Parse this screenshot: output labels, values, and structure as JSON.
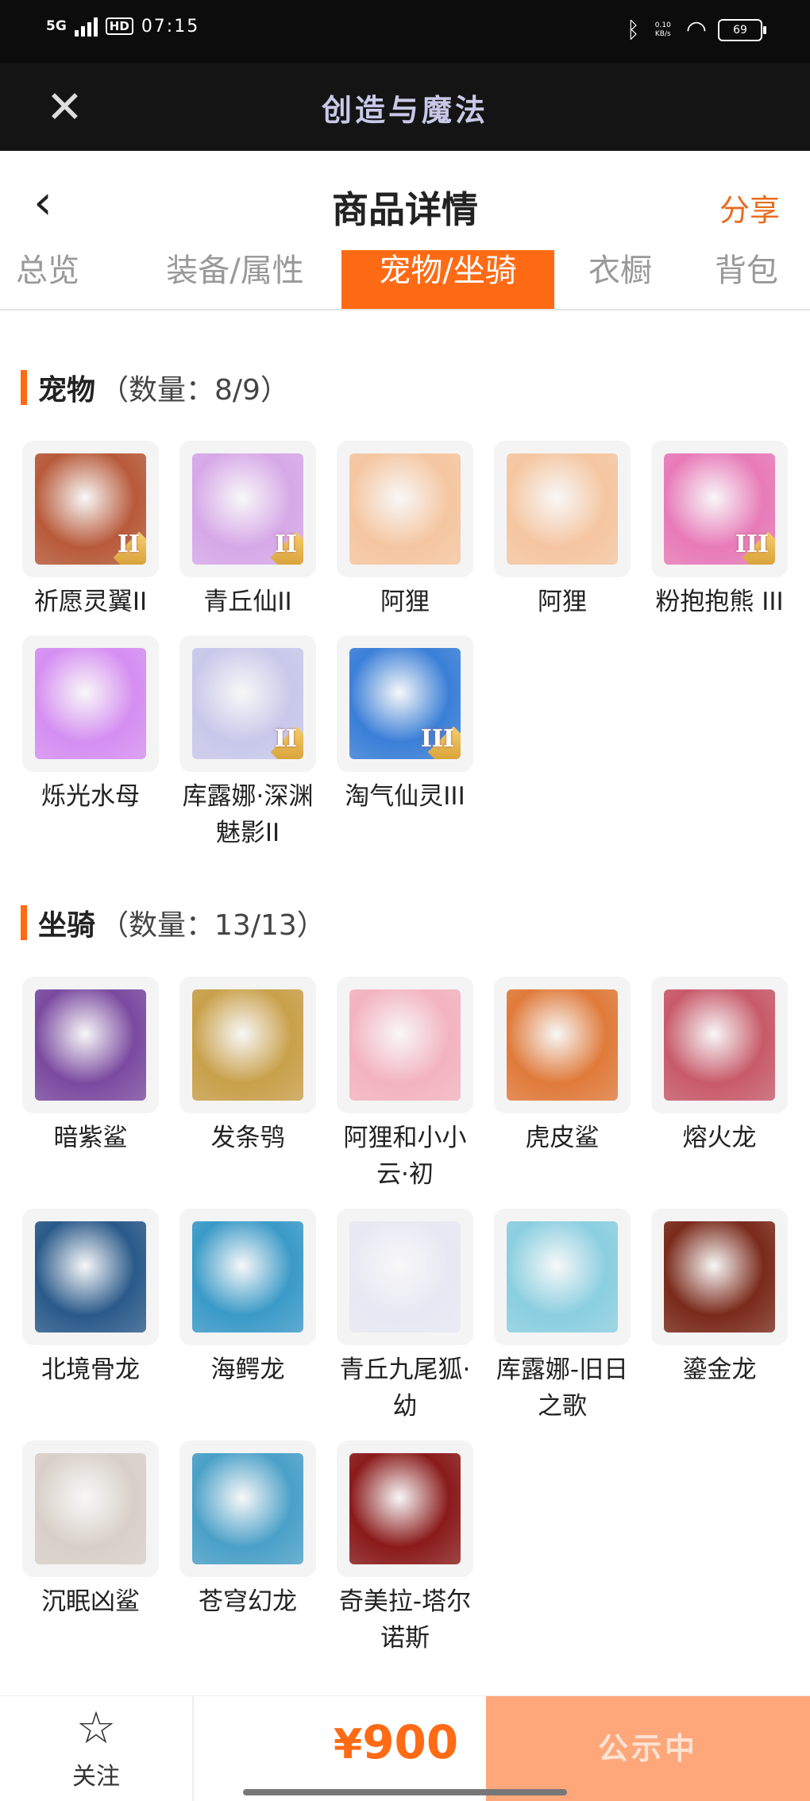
{
  "status_bar": {
    "network": "5G",
    "hd": "HD",
    "time": "07:15",
    "speed": "0.10 KB/s",
    "battery": "69"
  },
  "app_bar": {
    "title": "创造与魔法"
  },
  "nav": {
    "title": "商品详情",
    "share": "分享"
  },
  "tabs": [
    "总览",
    "装备/属性",
    "宠物/坐骑",
    "衣橱",
    "背包"
  ],
  "active_tab": "宠物/坐骑",
  "pets": {
    "label": "宠物",
    "count": "（数量：8/9）",
    "items": [
      {
        "name": "祈愿灵翼II",
        "rank": "II",
        "color": "#b85a3a"
      },
      {
        "name": "青丘仙II",
        "rank": "II",
        "color": "#d6a8e8"
      },
      {
        "name": "阿狸",
        "rank": "",
        "color": "#f5c6a0"
      },
      {
        "name": "阿狸",
        "rank": "",
        "color": "#f5c6a0"
      },
      {
        "name": "粉抱抱熊 III",
        "rank": "III",
        "color": "#e87ab8"
      },
      {
        "name": "烁光水母",
        "rank": "",
        "color": "#d58ef2"
      },
      {
        "name": "库露娜·深渊魅影II",
        "rank": "II",
        "color": "#c8c8ea"
      },
      {
        "name": "淘气仙灵III",
        "rank": "III",
        "color": "#3a7fd8"
      }
    ]
  },
  "mounts": {
    "label": "坐骑",
    "count": "（数量：13/13）",
    "items": [
      {
        "name": "暗紫鲨",
        "color": "#7a4aa0"
      },
      {
        "name": "发条鸮",
        "color": "#c9a04a"
      },
      {
        "name": "阿狸和小小云·初",
        "color": "#f3b3c0"
      },
      {
        "name": "虎皮鲨",
        "color": "#e07a3a"
      },
      {
        "name": "熔火龙",
        "color": "#c85a6a"
      },
      {
        "name": "北境骨龙",
        "color": "#2a5a8a"
      },
      {
        "name": "海鳄龙",
        "color": "#3a9ac8"
      },
      {
        "name": "青丘九尾狐·幼",
        "color": "#e8e8f4"
      },
      {
        "name": "库露娜-旧日之歌",
        "color": "#8acfe0"
      },
      {
        "name": "鎏金龙",
        "color": "#7a2a1a"
      },
      {
        "name": "沉眠凶鲨",
        "color": "#d8d0c8"
      },
      {
        "name": "苍穹幻龙",
        "color": "#4aa0c8"
      },
      {
        "name": "奇美拉-塔尔诺斯",
        "color": "#8a1a1a"
      }
    ]
  },
  "footer": {
    "follow": "关注",
    "currency": "¥",
    "price": "900",
    "status": "公示中"
  }
}
